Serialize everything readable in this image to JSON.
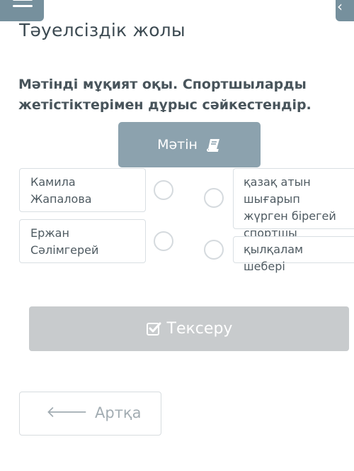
{
  "header": {
    "title": "Тәуелсіздік жолы"
  },
  "task": {
    "instruction": "Мәтінді мұқият оқы. Спортшыларды жетістіктерімен дұрыс сәйкестендір."
  },
  "text_button": {
    "label": "Мәтін",
    "icon": "book-icon"
  },
  "left_items": [
    {
      "label": "Камила Жапалова"
    },
    {
      "label": "Ержан Сәлімгерей"
    }
  ],
  "right_items": [
    {
      "label": "қазақ атын шығарып жүрген бірегей спортшы"
    },
    {
      "label": "қылқалам шебері"
    }
  ],
  "check_button": {
    "label": "Тексеру",
    "icon": "check-square-icon"
  },
  "back_button": {
    "label": "Артқа",
    "icon": "arrow-left-icon"
  },
  "colors": {
    "accent": "#8ca2ae",
    "top_bar": "#76909d",
    "disabled": "#c8cbcd"
  }
}
